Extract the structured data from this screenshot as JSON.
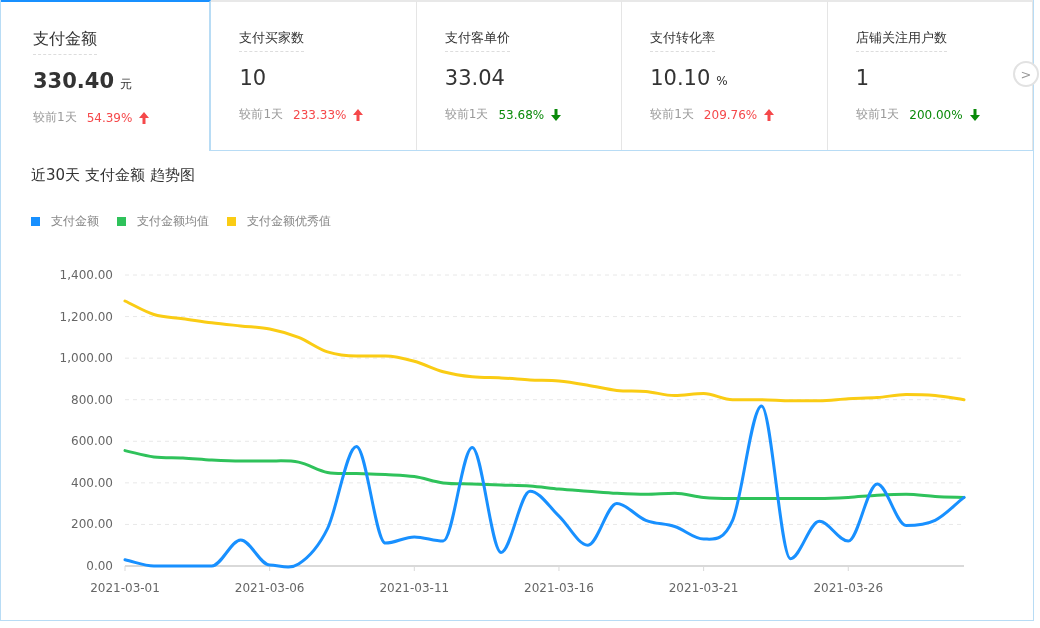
{
  "cards": [
    {
      "title": "支付金额",
      "value": "330.40",
      "unit": "元",
      "compare_label": "较前1天",
      "change": "54.39%",
      "increase": true,
      "selected": true
    },
    {
      "title": "支付买家数",
      "value": "10",
      "compare_label": "较前1天",
      "change": "233.33%",
      "increase": true,
      "selected": false
    },
    {
      "title": "支付客单价",
      "value": "33.04",
      "compare_label": "较前1天",
      "change": "53.68%",
      "increase": false,
      "selected": false
    },
    {
      "title": "支付转化率",
      "value": "10.10",
      "unit": "%",
      "compare_label": "较前1天",
      "change": "209.76%",
      "increase": true,
      "selected": false
    },
    {
      "title": "店铺关注用户数",
      "value": "1",
      "compare_label": "较前1天",
      "change": "200.00%",
      "increase": false,
      "selected": false
    }
  ],
  "next_button": ">",
  "chart_title": "近30天 支付金额 趋势图",
  "chart_data": {
    "type": "line",
    "categories": [
      "2021-03-01",
      null,
      null,
      null,
      null,
      "2021-03-06",
      null,
      null,
      null,
      null,
      "2021-03-11",
      null,
      null,
      null,
      null,
      "2021-03-16",
      null,
      null,
      null,
      null,
      "2021-03-21",
      null,
      null,
      null,
      null,
      "2021-03-26",
      null,
      null,
      null,
      null
    ],
    "ylim": [
      0,
      1400
    ],
    "grid": true,
    "yticks": [
      {
        "value": 0,
        "label": "0.00"
      },
      {
        "value": 200,
        "label": "200.00"
      },
      {
        "value": 400,
        "label": "400.00"
      },
      {
        "value": 600,
        "label": "600.00"
      },
      {
        "value": 800,
        "label": "800.00"
      },
      {
        "value": 1000,
        "label": "1,000.00"
      },
      {
        "value": 1200,
        "label": "1,200.00"
      },
      {
        "value": 1400,
        "label": "1,400.00"
      }
    ],
    "series": [
      {
        "name": "支付金额",
        "color": "#1890ff",
        "values": [
          30,
          0,
          0,
          0,
          125,
          5,
          10,
          180,
          575,
          110,
          140,
          120,
          570,
          65,
          360,
          240,
          100,
          300,
          220,
          190,
          130,
          220,
          770,
          35,
          215,
          120,
          395,
          195,
          220,
          330
        ]
      },
      {
        "name": "支付金额均值",
        "color": "#2fc25b",
        "values": [
          555,
          525,
          520,
          510,
          505,
          505,
          500,
          450,
          445,
          440,
          430,
          400,
          395,
          390,
          385,
          370,
          360,
          350,
          345,
          350,
          330,
          325,
          325,
          325,
          325,
          330,
          340,
          345,
          335,
          330
        ]
      },
      {
        "name": "支付金额优秀值",
        "color": "#facc14",
        "values": [
          1275,
          1210,
          1190,
          1170,
          1155,
          1140,
          1100,
          1030,
          1010,
          1010,
          985,
          935,
          910,
          905,
          895,
          890,
          870,
          845,
          840,
          820,
          830,
          800,
          800,
          795,
          795,
          805,
          810,
          825,
          820,
          800
        ]
      }
    ]
  }
}
